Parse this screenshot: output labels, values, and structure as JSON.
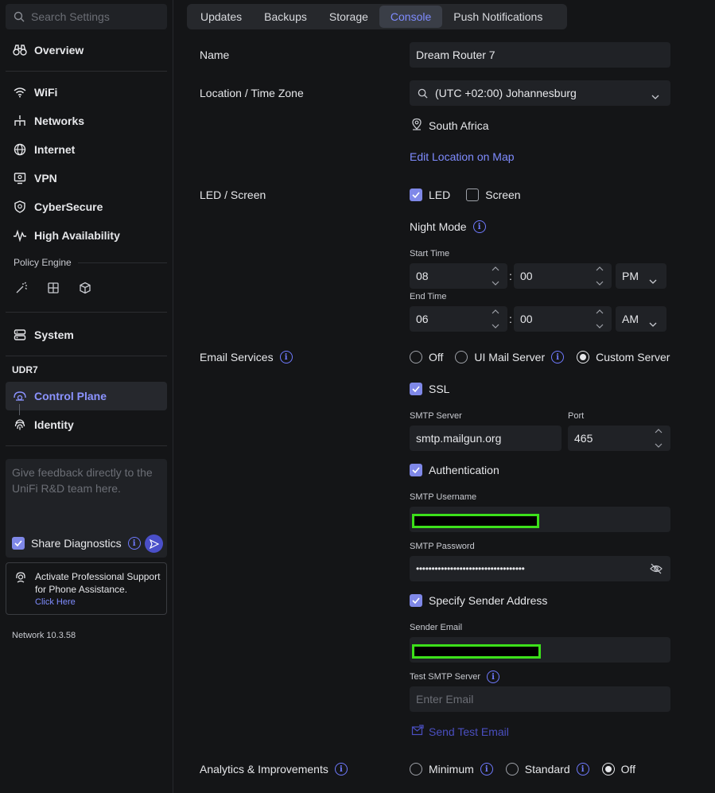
{
  "sidebar": {
    "search_placeholder": "Search Settings",
    "overview": "Overview",
    "items": [
      "WiFi",
      "Networks",
      "Internet",
      "VPN",
      "CyberSecure",
      "High Availability"
    ],
    "policy_engine": "Policy Engine",
    "system": "System",
    "device": "UDR7",
    "device_items": [
      "Control Plane",
      "Identity"
    ],
    "feedback_placeholder": "Give feedback directly to the UniFi R&D team here.",
    "share_diagnostics": "Share Diagnostics",
    "support_line1": "Activate Professional Support",
    "support_line2": "for Phone Assistance.",
    "support_link": "Click Here",
    "version": "Network 10.3.58"
  },
  "tabs": [
    "Updates",
    "Backups",
    "Storage",
    "Console",
    "Push Notifications"
  ],
  "active_tab": "Console",
  "form": {
    "name_label": "Name",
    "name_value": "Dream Router 7",
    "location_label": "Location / Time Zone",
    "timezone_value": "(UTC +02:00) Johannesburg",
    "country": "South Africa",
    "edit_location": "Edit Location on Map",
    "led_label": "LED / Screen",
    "led": "LED",
    "screen": "Screen",
    "night_mode": "Night Mode",
    "start_time": "Start Time",
    "start_hour": "08",
    "start_min": "00",
    "start_ampm": "PM",
    "end_time": "End Time",
    "end_hour": "06",
    "end_min": "00",
    "end_ampm": "AM",
    "colon": ":",
    "email_label": "Email Services",
    "email_off": "Off",
    "email_ui": "UI Mail Server",
    "email_custom": "Custom Server",
    "ssl": "SSL",
    "smtp_server_label": "SMTP Server",
    "smtp_server": "smtp.mailgun.org",
    "port_label": "Port",
    "port": "465",
    "authentication": "Authentication",
    "smtp_username_label": "SMTP Username",
    "smtp_password_label": "SMTP Password",
    "smtp_password": "•••••••••••••••••••••••••••••••••••",
    "specify_sender": "Specify Sender Address",
    "sender_email_label": "Sender Email",
    "test_smtp_label": "Test SMTP Server",
    "test_email_placeholder": "Enter Email",
    "send_test": "Send Test Email",
    "analytics_label": "Analytics & Improvements",
    "analytics_min": "Minimum",
    "analytics_std": "Standard",
    "analytics_off": "Off",
    "info_glyph": "i"
  },
  "colors": {
    "accent": "#7f8cff",
    "background": "#141517",
    "field": "#202226",
    "redact_border": "#3ce01a"
  }
}
